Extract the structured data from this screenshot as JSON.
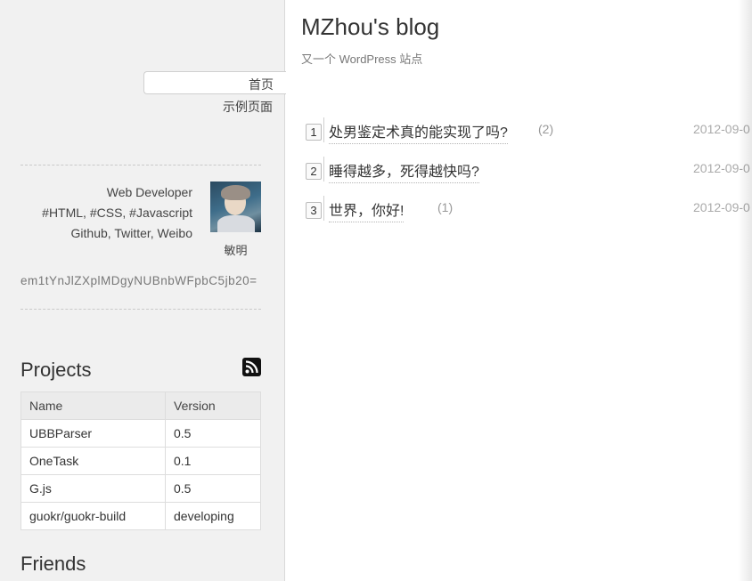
{
  "nav": {
    "items": [
      {
        "label": "首页",
        "active": true
      },
      {
        "label": "示例页面",
        "active": false
      }
    ]
  },
  "profile": {
    "lines": [
      "Web Developer",
      "#HTML, #CSS, #Javascript",
      "Github, Twitter, Weibo"
    ],
    "name": "敏明",
    "token": "em1tYnJlZXplMDgyNUBnbWFpbC5jb20="
  },
  "projects": {
    "title": "Projects",
    "rss_icon": "rss-icon",
    "columns": [
      "Name",
      "Version"
    ],
    "rows": [
      [
        "UBBParser",
        "0.5"
      ],
      [
        "OneTask",
        "0.1"
      ],
      [
        "G.js",
        "0.5"
      ],
      [
        "guokr/guokr-build",
        "developing"
      ]
    ]
  },
  "friends": {
    "title": "Friends"
  },
  "blog": {
    "title": "MZhou's blog",
    "subtitle": "又一个 WordPress 站点"
  },
  "posts": [
    {
      "num": "1",
      "title": "处男鉴定术真的能实现了吗?",
      "count": "(2)",
      "date": "2012-09-0"
    },
    {
      "num": "2",
      "title": "睡得越多，死得越快吗?",
      "count": "",
      "date": "2012-09-0"
    },
    {
      "num": "3",
      "title": "世界，你好!",
      "count": "(1)",
      "date": "2012-09-0"
    }
  ]
}
